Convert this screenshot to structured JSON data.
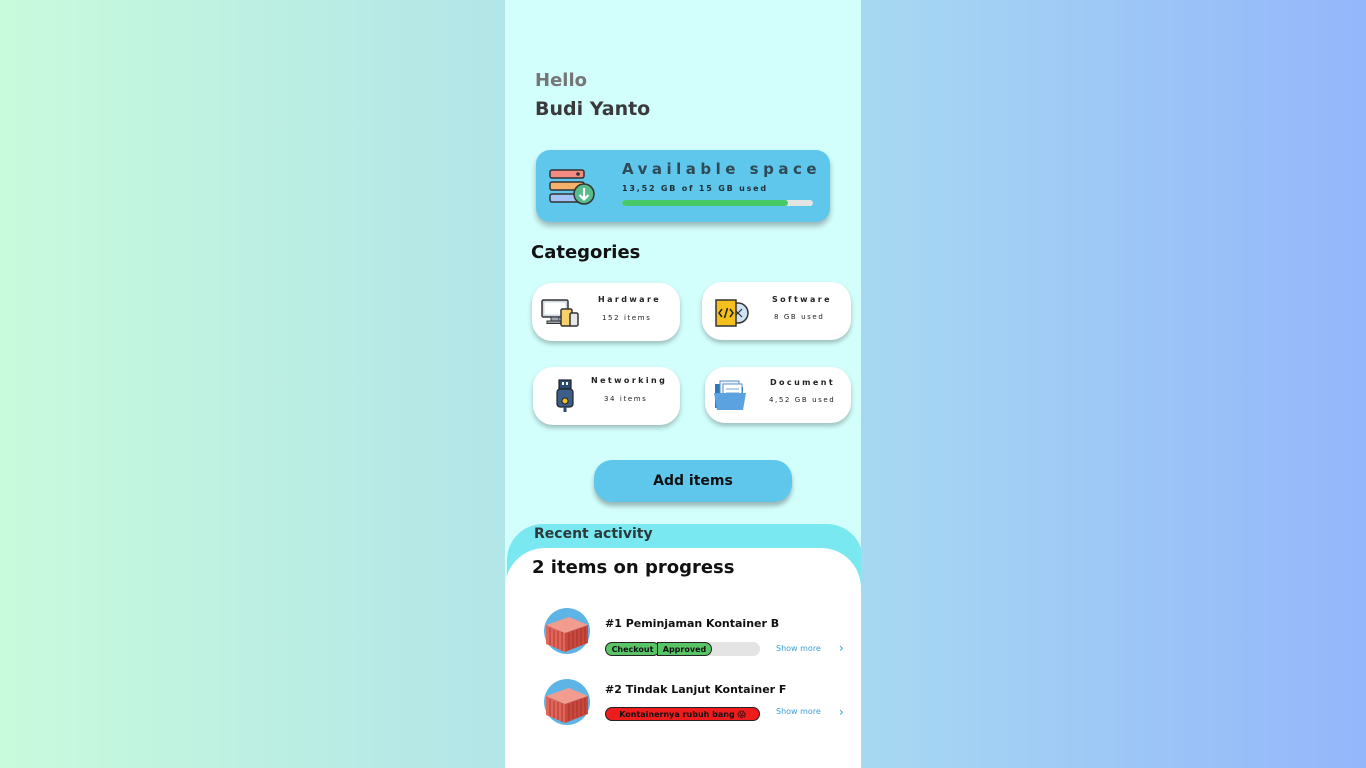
{
  "greeting": {
    "hello": "Hello",
    "name": "Budi Yanto"
  },
  "storage": {
    "title": "Available space",
    "usage_text": "13,52 GB of 15 GB used",
    "used_fraction": 0.869,
    "icon": "server-download-icon"
  },
  "categories": {
    "title": "Categories",
    "items": [
      {
        "name": "Hardware",
        "count": "152 items",
        "icon": "devices-icon"
      },
      {
        "name": "Software",
        "count": "8 GB used",
        "icon": "code-window-icon"
      },
      {
        "name": "Networking",
        "count": "34 items",
        "icon": "usb-connector-icon"
      },
      {
        "name": "Document",
        "count": "4,52 GB used",
        "icon": "folder-documents-icon"
      }
    ]
  },
  "actions": {
    "add_items": "Add items"
  },
  "recent": {
    "label": "Recent activity",
    "progress_title": "2 items on progress",
    "show_more": "Show more",
    "items": [
      {
        "title": "#1 Peminjaman Kontainer B",
        "stage1": "Checkout",
        "stage2": "Approved",
        "icon": "shipping-container-icon"
      },
      {
        "title": "#2 Tindak Lanjut Kontainer F",
        "status": "Kontainernya rubuh bang 😱",
        "icon": "shipping-container-icon"
      }
    ]
  },
  "colors": {
    "accent": "#5fc6ec",
    "progress_green": "#47c96a",
    "status_red": "#ee1c1c",
    "panel_bg": "#d2fefc",
    "recent_band": "#7ae8f0"
  }
}
